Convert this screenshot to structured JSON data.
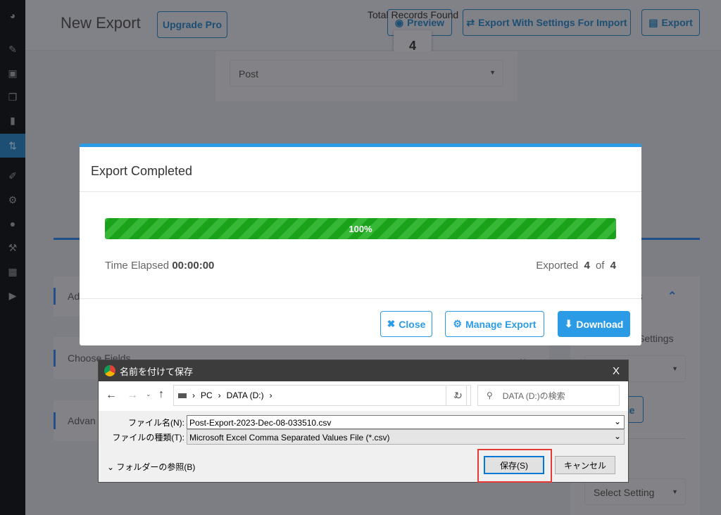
{
  "header": {
    "title": "New Export",
    "upgrade_label": "Upgrade Pro",
    "records_label": "Total Records Found",
    "records_count": "4",
    "preview_label": "Preview",
    "export_settings_label": "Export With Settings For Import",
    "export_label": "Export"
  },
  "post_type": {
    "value": "Post"
  },
  "cards": {
    "advanced": "Ad",
    "choose_fields": "Choose Fields",
    "advan": "Advan",
    "settings_right": "gs",
    "settings_label": "Settings",
    "te_btn": "te",
    "exports_label": "rts",
    "select_setting": "Select Setting"
  },
  "modal": {
    "title": "Export Completed",
    "progress_percent": 100,
    "progress_label": "100%",
    "time_label": "Time Elapsed",
    "time_value": "00:00:00",
    "exported_label": "Exported",
    "exported_count": "4",
    "of_label": "of",
    "total_count": "4",
    "close_label": "Close",
    "manage_label": "Manage Export",
    "download_label": "Download",
    "progress_color": "#1aa21a",
    "accent": "#2b9be5"
  },
  "dialog": {
    "title": "名前を付けて保存",
    "close": "X",
    "path": [
      "PC",
      "DATA (D:)"
    ],
    "search_placeholder": "DATA (D:)の検索",
    "filename_label": "ファイル名(N):",
    "filename_value": "Post-Export-2023-Dec-08-033510.csv",
    "filetype_label": "ファイルの種類(T):",
    "filetype_value": "Microsoft Excel Comma Separated Values File (*.csv)",
    "browse_label": "フォルダーの参照(B)",
    "save_label": "保存(S)",
    "cancel_label": "キャンセル",
    "highlight_color": "#e53935"
  }
}
